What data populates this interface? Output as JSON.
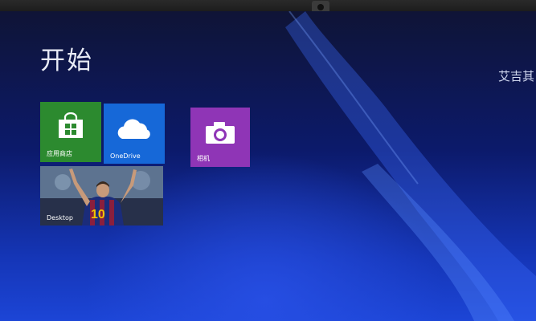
{
  "start_screen": {
    "title": "开始",
    "user_name": "艾吉其"
  },
  "tiles": [
    {
      "label": "应用商店",
      "icon": "store-bag-icon",
      "color": "#2c8a2f"
    },
    {
      "label": "OneDrive",
      "icon": "cloud-icon",
      "color": "#1668d8"
    },
    {
      "label": "相机",
      "icon": "camera-icon",
      "color": "#8f35b6"
    },
    {
      "label": "Desktop",
      "icon": "desktop-wallpaper-image",
      "color": "#3d4e66",
      "jersey_number": "10"
    }
  ]
}
